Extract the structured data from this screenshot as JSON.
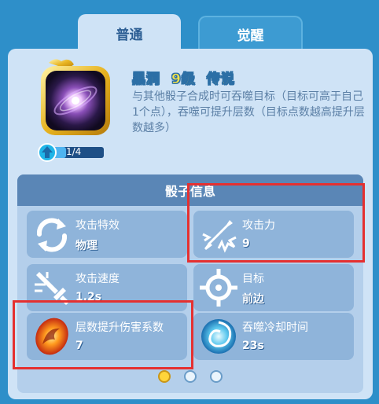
{
  "tabs": [
    {
      "label": "普通",
      "active": true
    },
    {
      "label": "觉醒",
      "active": false
    }
  ],
  "dice": {
    "name": "黑洞",
    "level": "9级",
    "rarity": "传说",
    "description": "与其他骰子合成时可吞噬目标（目标可高于自己1个点），吞噬可提升层数（目标点数越高提升层数越多）",
    "upgrade_progress": {
      "text": "1/4",
      "current": 1,
      "total": 4
    }
  },
  "info_section": {
    "title": "骰子信息",
    "stats": [
      {
        "label": "攻击特效",
        "value": "物理",
        "icon": "swap-arrows-icon"
      },
      {
        "label": "攻击力",
        "value": "9",
        "icon": "sword-impact-icon"
      },
      {
        "label": "攻击速度",
        "value": "1.2s",
        "icon": "sword-speed-icon"
      },
      {
        "label": "目标",
        "value": "前边",
        "icon": "crosshair-icon"
      },
      {
        "label": "层数提升伤害系数",
        "value": "7",
        "icon": "fire-swirl-icon"
      },
      {
        "label": "吞噬冷却时间",
        "value": "23s",
        "icon": "vortex-icon"
      }
    ]
  },
  "pagination": {
    "pages": 3,
    "current": 1
  },
  "colors": {
    "highlight_box": "#e53030",
    "title_gold": "#f3e24a",
    "accent_blue": "#2e8fc9"
  }
}
